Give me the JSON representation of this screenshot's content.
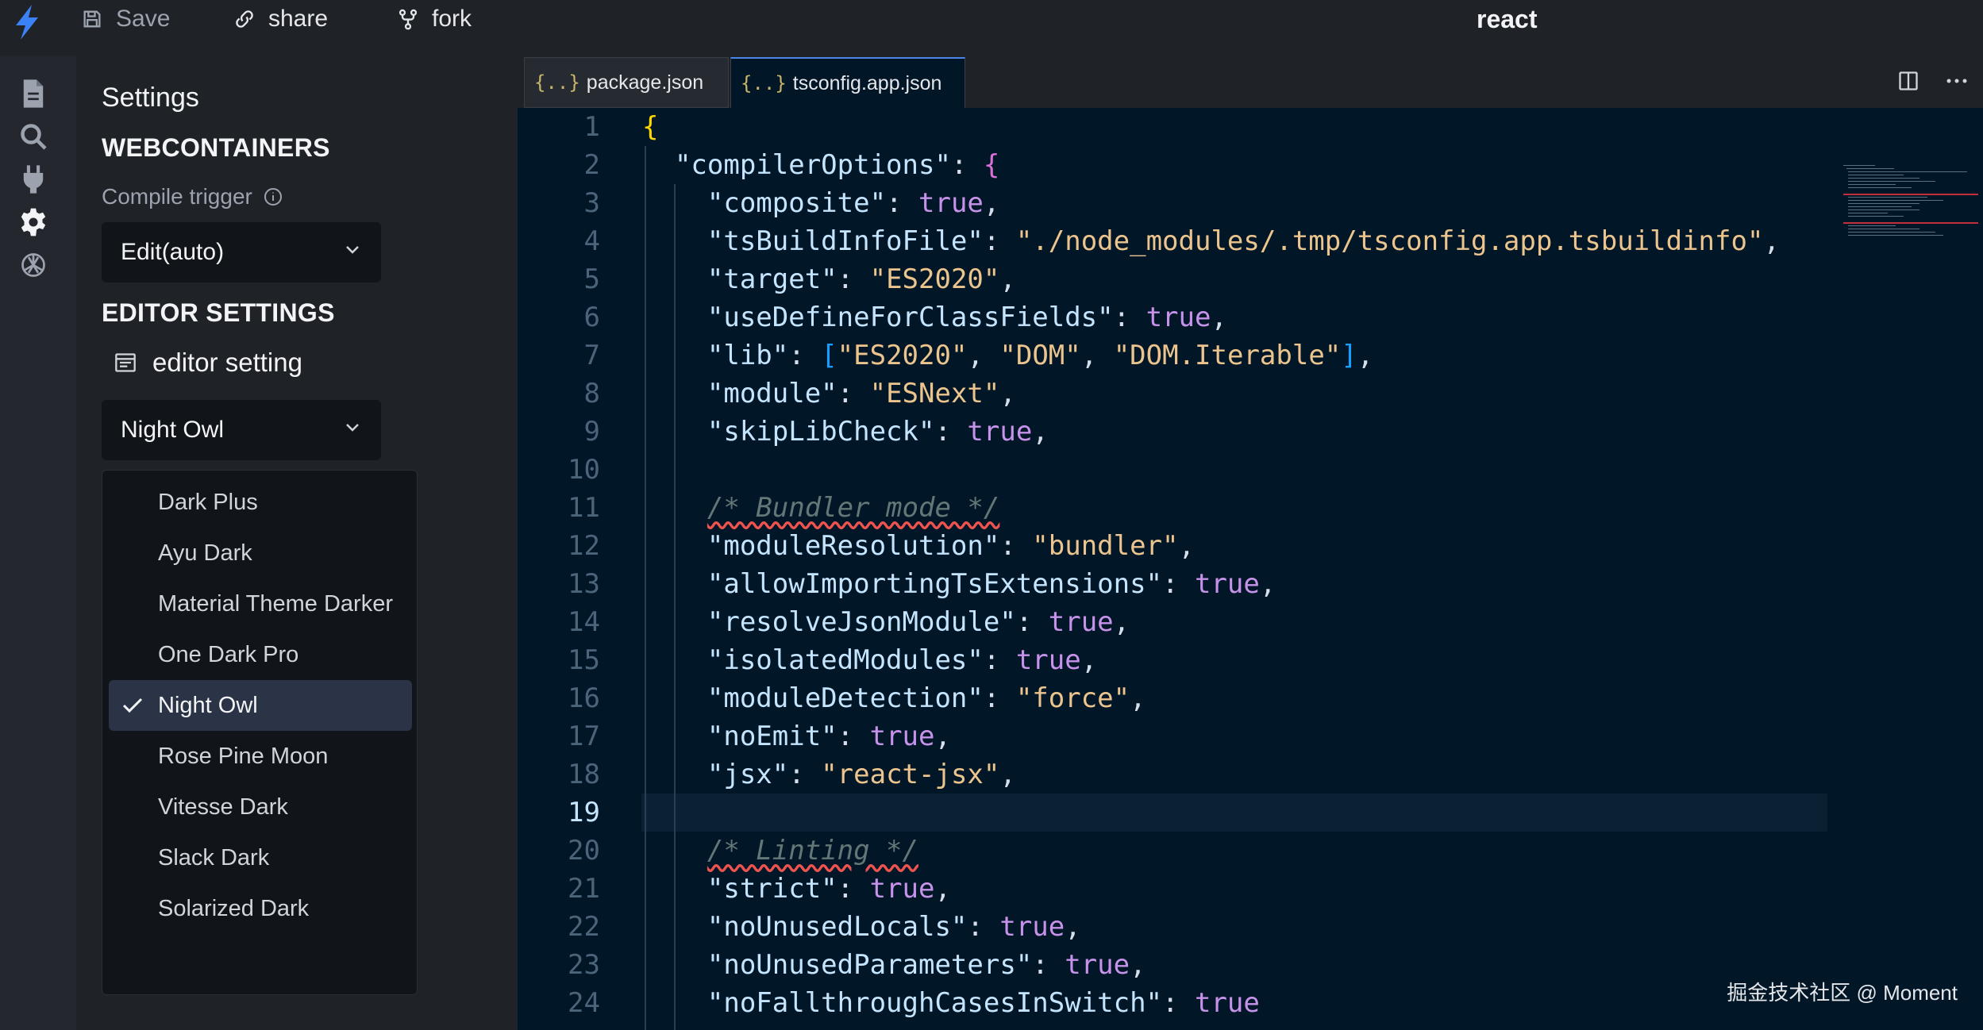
{
  "topbar": {
    "save_label": "Save",
    "share_label": "share",
    "fork_label": "fork",
    "project_title": "react",
    "logo_icon": "bolt-icon",
    "accent_color": "#3b82f6"
  },
  "activity_bar": {
    "items": [
      "file-icon",
      "search-icon",
      "plug-icon",
      "gear-icon",
      "openai-icon"
    ]
  },
  "settings": {
    "title": "Settings",
    "webcontainers_heading": "WEBCONTAINERS",
    "compile_trigger_label": "Compile trigger",
    "compile_trigger_value": "Edit(auto)",
    "editor_settings_heading": "EDITOR SETTINGS",
    "editor_setting_label": "editor setting",
    "theme_value": "Night Owl",
    "theme_options": [
      {
        "label": "Dark Plus",
        "selected": false
      },
      {
        "label": "Ayu Dark",
        "selected": false
      },
      {
        "label": "Material Theme Darker",
        "selected": false
      },
      {
        "label": "One Dark Pro",
        "selected": false
      },
      {
        "label": "Night Owl",
        "selected": true
      },
      {
        "label": "Rose Pine Moon",
        "selected": false
      },
      {
        "label": "Vitesse Dark",
        "selected": false
      },
      {
        "label": "Slack Dark",
        "selected": false
      },
      {
        "label": "Solarized Dark",
        "selected": false
      }
    ]
  },
  "editor": {
    "tabs": [
      {
        "label": "package.json",
        "icon": "{..}",
        "active": false
      },
      {
        "label": "tsconfig.app.json",
        "icon": "{..}",
        "active": true
      }
    ],
    "active_line": 19,
    "lines": [
      [
        [
          "br1",
          "{"
        ]
      ],
      [
        [
          "k",
          "  \"compilerOptions\""
        ],
        [
          "p",
          ": "
        ],
        [
          "br2",
          "{"
        ]
      ],
      [
        [
          "k",
          "    \"composite\""
        ],
        [
          "p",
          ": "
        ],
        [
          "b",
          "true"
        ],
        [
          "p",
          ","
        ]
      ],
      [
        [
          "k",
          "    \"tsBuildInfoFile\""
        ],
        [
          "p",
          ": "
        ],
        [
          "s",
          "\"./node_modules/.tmp/tsconfig.app.tsbuildinfo\""
        ],
        [
          "p",
          ","
        ]
      ],
      [
        [
          "k",
          "    \"target\""
        ],
        [
          "p",
          ": "
        ],
        [
          "s",
          "\"ES2020\""
        ],
        [
          "p",
          ","
        ]
      ],
      [
        [
          "k",
          "    \"useDefineForClassFields\""
        ],
        [
          "p",
          ": "
        ],
        [
          "b",
          "true"
        ],
        [
          "p",
          ","
        ]
      ],
      [
        [
          "k",
          "    \"lib\""
        ],
        [
          "p",
          ": "
        ],
        [
          "br3",
          "["
        ],
        [
          "s",
          "\"ES2020\""
        ],
        [
          "p",
          ", "
        ],
        [
          "s",
          "\"DOM\""
        ],
        [
          "p",
          ", "
        ],
        [
          "s",
          "\"DOM.Iterable\""
        ],
        [
          "br3",
          "]"
        ],
        [
          "p",
          ","
        ]
      ],
      [
        [
          "k",
          "    \"module\""
        ],
        [
          "p",
          ": "
        ],
        [
          "s",
          "\"ESNext\""
        ],
        [
          "p",
          ","
        ]
      ],
      [
        [
          "k",
          "    \"skipLibCheck\""
        ],
        [
          "p",
          ": "
        ],
        [
          "b",
          "true"
        ],
        [
          "p",
          ","
        ]
      ],
      [],
      [
        [
          "p",
          "    "
        ],
        [
          "c",
          "/* Bundler mode */"
        ]
      ],
      [
        [
          "k",
          "    \"moduleResolution\""
        ],
        [
          "p",
          ": "
        ],
        [
          "s",
          "\"bundler\""
        ],
        [
          "p",
          ","
        ]
      ],
      [
        [
          "k",
          "    \"allowImportingTsExtensions\""
        ],
        [
          "p",
          ": "
        ],
        [
          "b",
          "true"
        ],
        [
          "p",
          ","
        ]
      ],
      [
        [
          "k",
          "    \"resolveJsonModule\""
        ],
        [
          "p",
          ": "
        ],
        [
          "b",
          "true"
        ],
        [
          "p",
          ","
        ]
      ],
      [
        [
          "k",
          "    \"isolatedModules\""
        ],
        [
          "p",
          ": "
        ],
        [
          "b",
          "true"
        ],
        [
          "p",
          ","
        ]
      ],
      [
        [
          "k",
          "    \"moduleDetection\""
        ],
        [
          "p",
          ": "
        ],
        [
          "s",
          "\"force\""
        ],
        [
          "p",
          ","
        ]
      ],
      [
        [
          "k",
          "    \"noEmit\""
        ],
        [
          "p",
          ": "
        ],
        [
          "b",
          "true"
        ],
        [
          "p",
          ","
        ]
      ],
      [
        [
          "k",
          "    \"jsx\""
        ],
        [
          "p",
          ": "
        ],
        [
          "s",
          "\"react-jsx\""
        ],
        [
          "p",
          ","
        ]
      ],
      [],
      [
        [
          "p",
          "    "
        ],
        [
          "c",
          "/* Linting */"
        ]
      ],
      [
        [
          "k",
          "    \"strict\""
        ],
        [
          "p",
          ": "
        ],
        [
          "b",
          "true"
        ],
        [
          "p",
          ","
        ]
      ],
      [
        [
          "k",
          "    \"noUnusedLocals\""
        ],
        [
          "p",
          ": "
        ],
        [
          "b",
          "true"
        ],
        [
          "p",
          ","
        ]
      ],
      [
        [
          "k",
          "    \"noUnusedParameters\""
        ],
        [
          "p",
          ": "
        ],
        [
          "b",
          "true"
        ],
        [
          "p",
          ","
        ]
      ],
      [
        [
          "k",
          "    \"noFallthroughCasesInSwitch\""
        ],
        [
          "p",
          ": "
        ],
        [
          "b",
          "true"
        ]
      ]
    ]
  },
  "watermark": "掘金技术社区 @ Moment"
}
